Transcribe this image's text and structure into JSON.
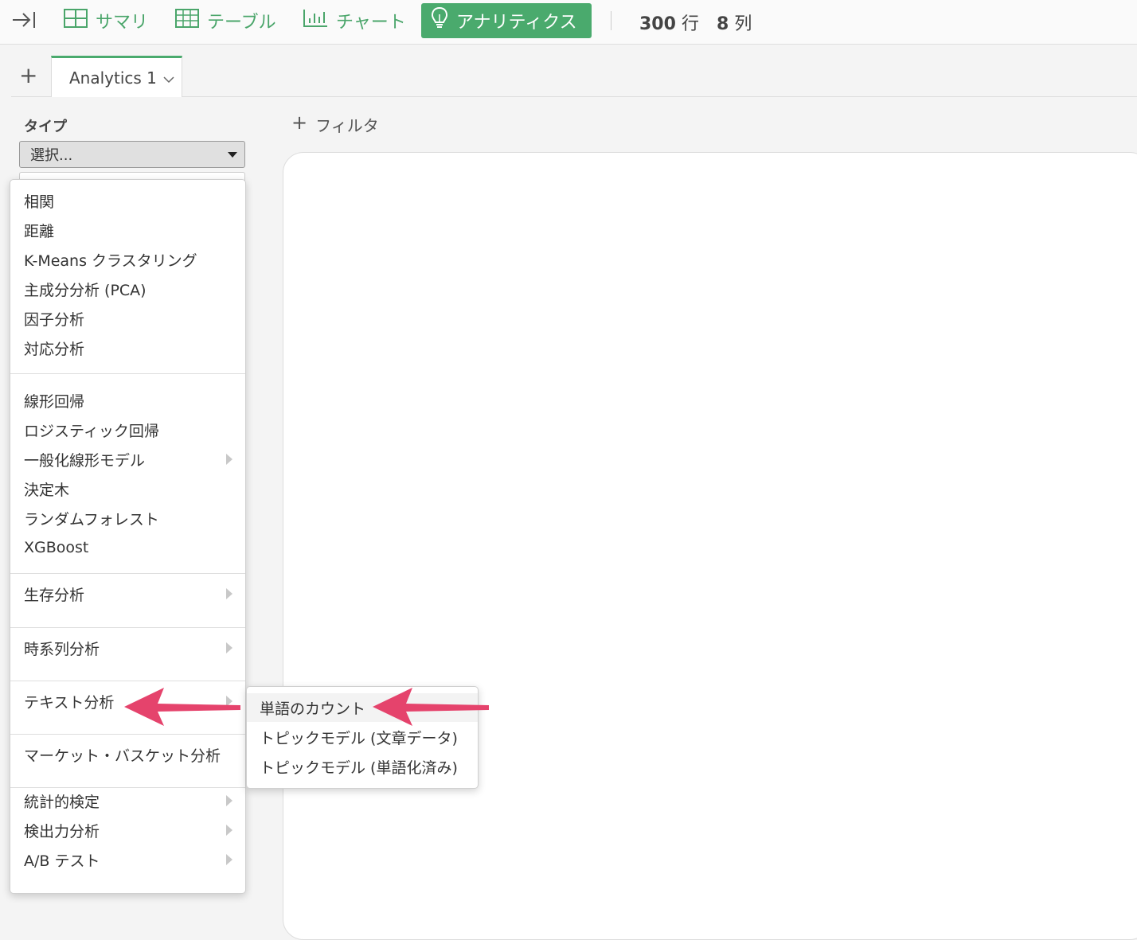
{
  "toolbar": {
    "tabs": [
      {
        "label": "サマリ",
        "icon": "grid-icon"
      },
      {
        "label": "テーブル",
        "icon": "table-icon"
      },
      {
        "label": "チャート",
        "icon": "bar-chart-icon"
      },
      {
        "label": "アナリティクス",
        "icon": "lightbulb-icon",
        "active": true
      }
    ],
    "rows_value": "300",
    "rows_unit": "行",
    "cols_value": "8",
    "cols_unit": "列"
  },
  "tabbar": {
    "add_label": "+",
    "current_tab": "Analytics 1"
  },
  "left_panel": {
    "type_label": "タイプ",
    "select_value": "選択..."
  },
  "main": {
    "filter_label": "フィルタ"
  },
  "menu": {
    "groups": [
      [
        "相関",
        "距離",
        "K-Means クラスタリング",
        "主成分分析 (PCA)",
        "因子分析",
        "対応分析"
      ],
      [
        "線形回帰",
        "ロジスティック回帰",
        "一般化線形モデル",
        "決定木",
        "ランダムフォレスト",
        "XGBoost"
      ],
      [
        "生存分析"
      ],
      [
        "時系列分析"
      ],
      [
        "テキスト分析"
      ],
      [
        "マーケット・バスケット分析"
      ],
      [
        "統計的検定",
        "検出力分析",
        "A/B テスト"
      ]
    ],
    "submenu_parents": [
      "一般化線形モデル",
      "生存分析",
      "時系列分析",
      "テキスト分析",
      "統計的検定",
      "検出力分析",
      "A/B テスト"
    ]
  },
  "submenu": {
    "items": [
      "単語のカウント",
      "トピックモデル (文章データ)",
      "トピックモデル (単語化済み)"
    ],
    "highlighted": "単語のカウント"
  },
  "colors": {
    "accent": "#4aaa6d",
    "annotation": "#e5436c"
  }
}
